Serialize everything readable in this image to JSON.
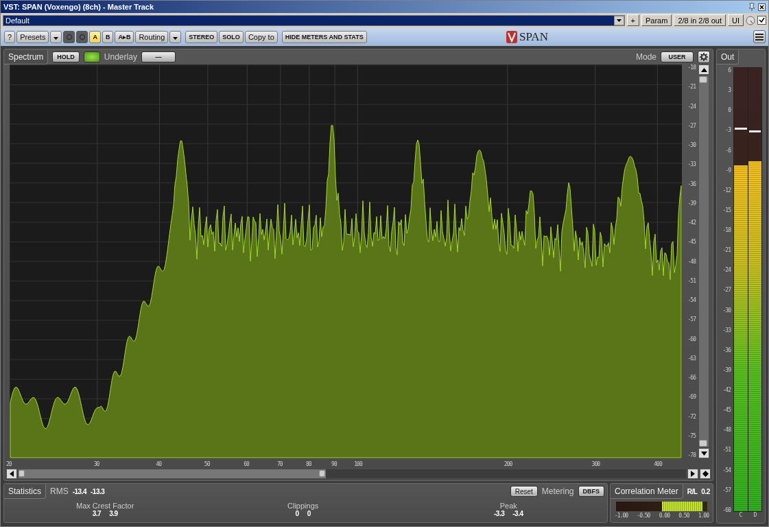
{
  "window": {
    "title": "VST: SPAN (Voxengo) (8ch) - Master Track"
  },
  "preset_bar": {
    "preset": "Default",
    "buttons": [
      "+",
      "Param",
      "2/8 in 2/8 out",
      "UI"
    ],
    "enabled": true
  },
  "toolbar": {
    "help": "?",
    "presets": "Presets",
    "ab": [
      {
        "label": "A",
        "selected": true
      },
      {
        "label": "B",
        "selected": false
      }
    ],
    "copy_ab": "A▸B",
    "routing": "Routing",
    "buttons": [
      "STEREO",
      "SOLO",
      "Copy to",
      "HIDE METERS AND STATS"
    ],
    "logo": "SPAN"
  },
  "spectrum": {
    "tab": "Spectrum",
    "hold": "HOLD",
    "show_on": true,
    "underlay_label": "Underlay",
    "underlay_value": "—",
    "mode_label": "Mode",
    "mode_value": "USER",
    "db_labels": [
      "-18",
      "-21",
      "-24",
      "-27",
      "-30",
      "-33",
      "-36",
      "-39",
      "-42",
      "-45",
      "-48",
      "-51",
      "-54",
      "-57",
      "-60",
      "-63",
      "-66",
      "-69",
      "-72",
      "-75",
      "-78"
    ],
    "freq_labels": [
      "20",
      "30",
      "40",
      "50",
      "60",
      "70",
      "80",
      "90",
      "100",
      "200",
      "300",
      "400"
    ]
  },
  "statistics": {
    "tab": "Statistics",
    "rms_label": "RMS",
    "rms": [
      "-13.4",
      "-13.3"
    ],
    "reset": "Reset",
    "metering_label": "Metering",
    "metering_value": "DBFS",
    "groups": [
      {
        "label": "Max Crest Factor",
        "values": [
          "3.7",
          "3.9"
        ]
      },
      {
        "label": "Clippings",
        "values": [
          "0",
          "0"
        ]
      },
      {
        "label": "Peak",
        "values": [
          "-3.3",
          "-3.4"
        ]
      }
    ]
  },
  "correlation": {
    "tab": "Correlation Meter",
    "channels": "R/L",
    "value": "0.2",
    "level": 0.95,
    "scale": [
      "-1.00",
      "-0.50",
      "0.00",
      "0.50",
      "1.00"
    ]
  },
  "out_meter": {
    "tab": "Out",
    "scale": [
      "6",
      "3",
      "0",
      "-3",
      "-6",
      "-9",
      "-12",
      "-15",
      "-18",
      "-21",
      "-24",
      "-27",
      "-30",
      "-33",
      "-36",
      "-39",
      "-42",
      "-45",
      "-48",
      "-51",
      "-54",
      "-57",
      "-60"
    ],
    "channels": [
      {
        "label": "C",
        "level": 0.78,
        "peak_hold": {
          "level": 0.86
        }
      },
      {
        "label": "D",
        "level": 0.79,
        "peak_hold": {
          "level": 0.855
        }
      }
    ]
  }
}
